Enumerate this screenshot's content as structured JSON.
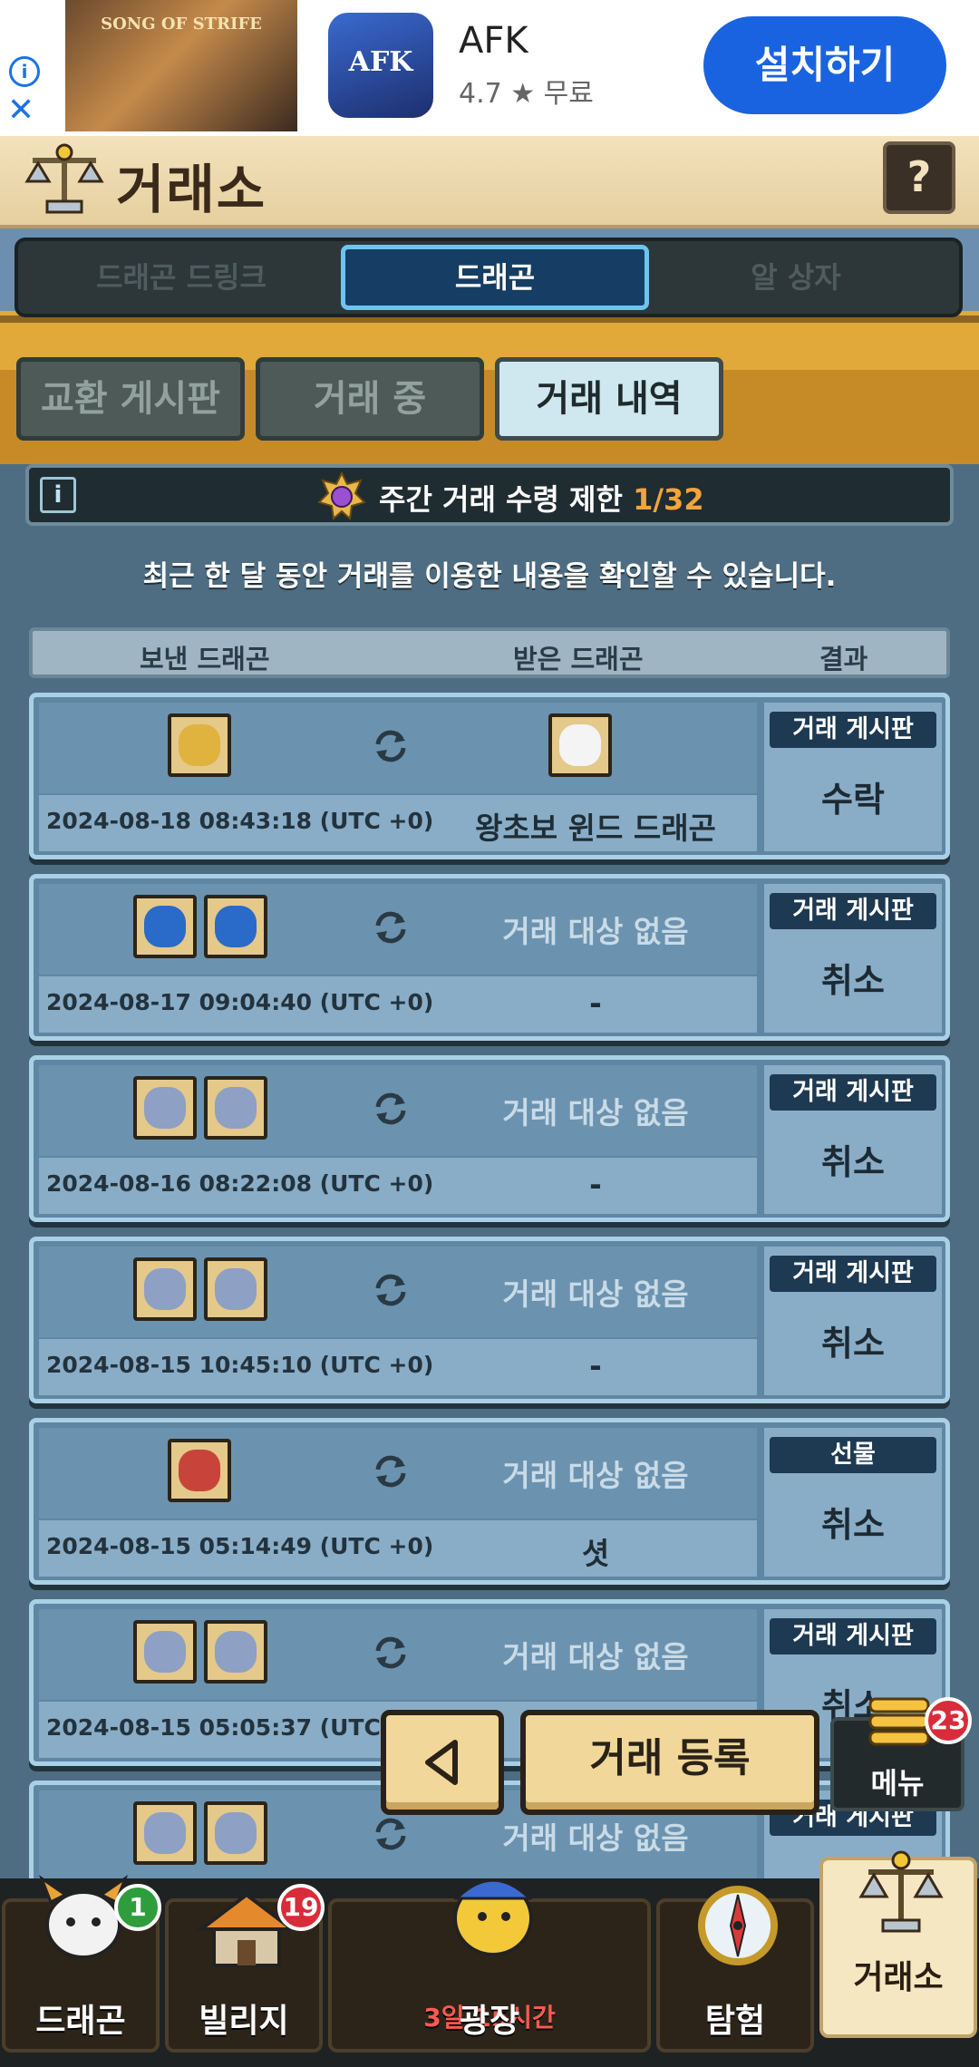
{
  "ad": {
    "banner_text": "SONG OF STRIFE",
    "app_icon_text": "AFK",
    "app_name": "AFK",
    "rating": "4.7 ★  무료",
    "install_label": "설치하기"
  },
  "header": {
    "title": "거래소",
    "help": "?"
  },
  "segments": [
    "드래곤 드링크",
    "드래곤",
    "알 상자"
  ],
  "active_segment": 1,
  "tabs": [
    "교환 게시판",
    "거래 중",
    "거래 내역"
  ],
  "active_tab": 2,
  "limit": {
    "info": "i",
    "label": "주간 거래 수령 제한 ",
    "count": "1/32"
  },
  "notice": "최근 한 달 동안 거래를 이용한 내용을 확인할 수 있습니다.",
  "columns": {
    "sent": "보낸 드래곤",
    "received": "받은 드래곤",
    "result": "결과"
  },
  "rows": [
    {
      "date": "2024-08-18 08:43:18 (UTC +0)",
      "placeholder": "",
      "received": "왕초보 윈드 드래곤",
      "type": "거래 게시판",
      "result": "수락"
    },
    {
      "date": "2024-08-17 09:04:40 (UTC +0)",
      "placeholder": "거래 대상 없음",
      "received": "-",
      "type": "거래 게시판",
      "result": "취소"
    },
    {
      "date": "2024-08-16 08:22:08 (UTC +0)",
      "placeholder": "거래 대상 없음",
      "received": "-",
      "type": "거래 게시판",
      "result": "취소"
    },
    {
      "date": "2024-08-15 10:45:10 (UTC +0)",
      "placeholder": "거래 대상 없음",
      "received": "-",
      "type": "거래 게시판",
      "result": "취소"
    },
    {
      "date": "2024-08-15 05:14:49 (UTC +0)",
      "placeholder": "거래 대상 없음",
      "received": "셧",
      "type": "선물",
      "result": "취소"
    },
    {
      "date": "2024-08-15 05:05:37 (UTC +0)",
      "placeholder": "거래 대상 없음",
      "received": "",
      "type": "거래 게시판",
      "result": "취소"
    },
    {
      "date": "",
      "placeholder": "거래 대상 없음",
      "received": "",
      "type": "거래 게시판",
      "result": ""
    }
  ],
  "actions": {
    "register": "거래 등록",
    "menu": "메뉴",
    "menu_badge": "23"
  },
  "nav": {
    "dragon": {
      "label": "드래곤",
      "badge": "1"
    },
    "village": {
      "label": "빌리지",
      "badge": "19"
    },
    "plaza": {
      "label": "광장",
      "timer": "3일 15시간"
    },
    "explore": {
      "label": "탐험"
    },
    "exchange": {
      "label": "거래소"
    }
  },
  "colors": {
    "accent": "#f5a33a",
    "badge_red": "#d82c3a",
    "badge_green": "#2e9d3c"
  }
}
